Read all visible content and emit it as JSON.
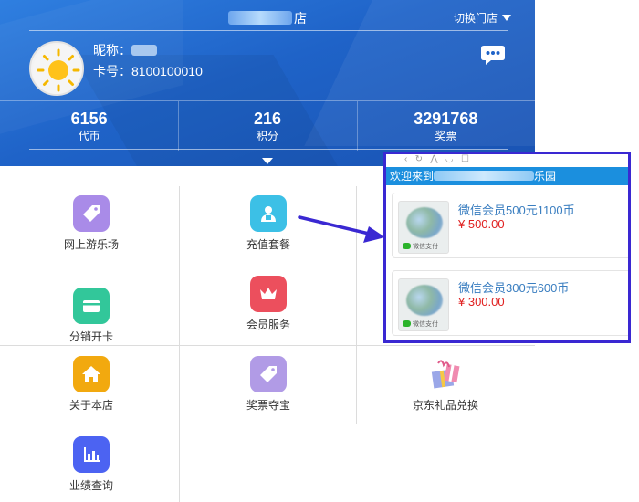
{
  "header": {
    "store_name_suffix": "店",
    "switch_store_label": "切换门店",
    "nickname_label": "昵称：",
    "card_label": "卡号：",
    "card_number": "8100100010",
    "stats": [
      {
        "value": "6156",
        "label": "代币"
      },
      {
        "value": "216",
        "label": "积分"
      },
      {
        "value": "3291768",
        "label": "奖票"
      }
    ]
  },
  "menu": {
    "items": [
      {
        "label": "网上游乐场",
        "icon": "tag-icon",
        "color": "#a98be8"
      },
      {
        "label": "充值套餐",
        "icon": "person-card-icon",
        "color": "#3cc0e6"
      },
      {
        "label": "分销开卡",
        "icon": "card-icon",
        "color": "#32c79a"
      },
      {
        "label": "会员服务",
        "icon": "crown-icon",
        "color": "#ec4f5d"
      },
      {
        "label": "关于本店",
        "icon": "home-icon",
        "color": "#f2a90f"
      },
      {
        "label": "奖票夺宝",
        "icon": "tag-icon",
        "color": "#b19be6"
      },
      {
        "label": "京东礼品兑换",
        "icon": "gift-icon",
        "color": "#e87aa2"
      },
      {
        "label": "业绩查询",
        "icon": "bar-chart-icon",
        "color": "#4c63f2"
      }
    ]
  },
  "popup": {
    "title_prefix": "欢迎来到",
    "title_suffix": "乐园",
    "packages": [
      {
        "name": "微信会员500元1100币",
        "price": "¥ 500.00",
        "pay_label": "微信支付"
      },
      {
        "name": "微信会员300元600币",
        "price": "¥ 300.00",
        "pay_label": "微信支付"
      }
    ]
  },
  "colors": {
    "header_blue": "#1f63c8",
    "popup_border": "#3a28d2",
    "price_red": "#e02020",
    "link_blue": "#3a7ec0",
    "popup_title_bar": "#1b8fde"
  }
}
